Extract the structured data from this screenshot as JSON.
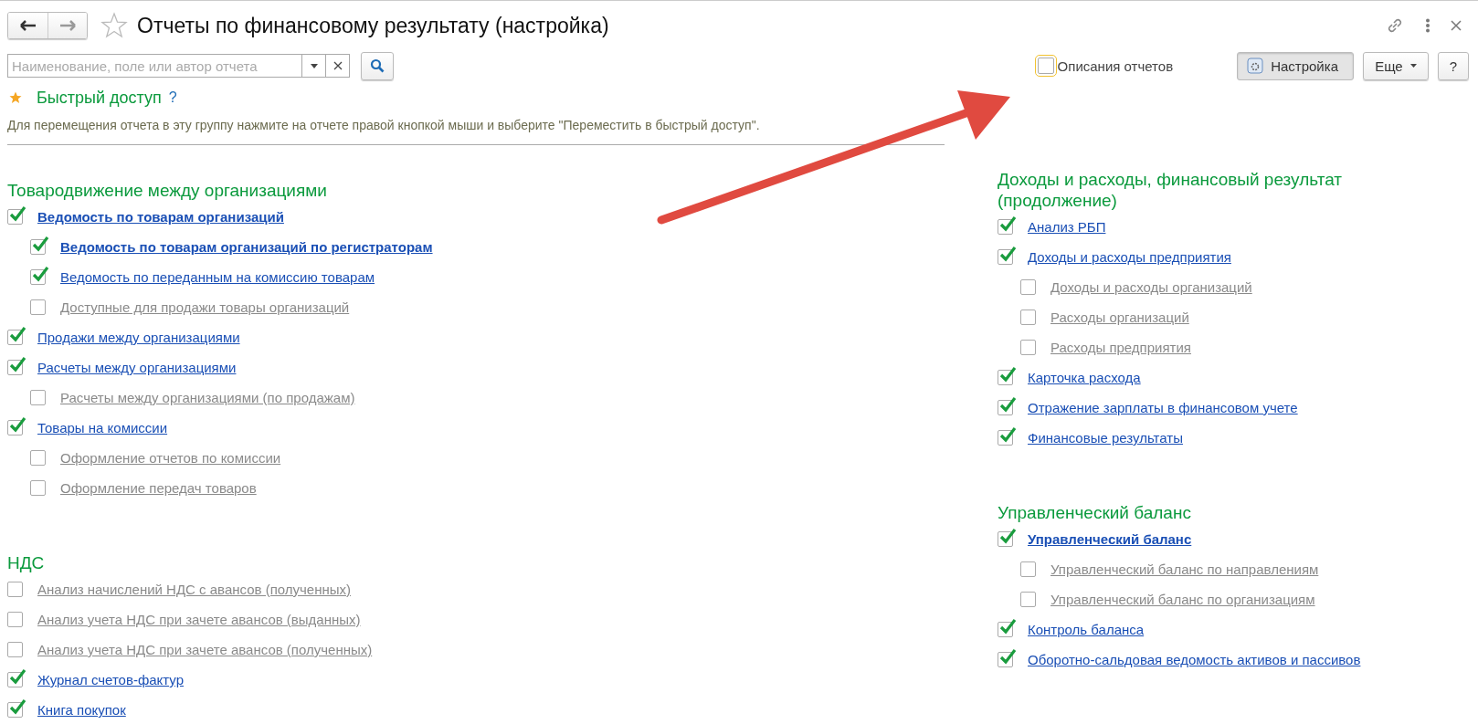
{
  "window": {
    "title": "Отчеты по финансовому результату (настройка)",
    "favorite": false
  },
  "search": {
    "placeholder": "Наименование, поле или автор отчета"
  },
  "descriptions_toggle": {
    "label": "Описания отчетов",
    "checked": false
  },
  "buttons": [
    {
      "kind": "settings",
      "label": "Настройка",
      "pressed": true
    },
    {
      "kind": "menu",
      "label": "Еще",
      "pressed": false
    },
    {
      "kind": "help",
      "label": "?",
      "pressed": false
    }
  ],
  "quick_access": {
    "title": "Быстрый доступ",
    "help": "?",
    "hint": "Для перемещения отчета в эту группу нажмите на отчете правой кнопкой мыши и выберите \"Переместить в быстрый доступ\"."
  },
  "columns": [
    {
      "groups": [
        {
          "title": "Товародвижение между организациями",
          "items": [
            {
              "label": "Ведомость по товарам организаций",
              "checked": true,
              "bold": true,
              "children": [
                {
                  "label": "Ведомость по товарам организаций по регистраторам",
                  "checked": true,
                  "bold": true
                },
                {
                  "label": "Ведомость по переданным на комиссию товарам",
                  "checked": true,
                  "bold": false
                },
                {
                  "label": "Доступные для продажи товары организаций",
                  "checked": false,
                  "bold": false
                }
              ]
            },
            {
              "label": "Продажи между организациями",
              "checked": true,
              "bold": false
            },
            {
              "label": "Расчеты между организациями",
              "checked": true,
              "bold": false,
              "children": [
                {
                  "label": "Расчеты между организациями (по продажам)",
                  "checked": false,
                  "bold": false
                }
              ]
            },
            {
              "label": "Товары на комиссии",
              "checked": true,
              "bold": false,
              "children": [
                {
                  "label": "Оформление отчетов по комиссии",
                  "checked": false,
                  "bold": false
                },
                {
                  "label": "Оформление передач товаров",
                  "checked": false,
                  "bold": false
                }
              ]
            }
          ]
        },
        {
          "title": "НДС",
          "items": [
            {
              "label": "Анализ начислений НДС с авансов (полученных)",
              "checked": false,
              "bold": false
            },
            {
              "label": "Анализ учета НДС при зачете авансов (выданных)",
              "checked": false,
              "bold": false
            },
            {
              "label": "Анализ учета НДС при зачете авансов (полученных)",
              "checked": false,
              "bold": false
            },
            {
              "label": "Журнал счетов-фактур",
              "checked": true,
              "bold": false
            },
            {
              "label": "Книга покупок",
              "checked": true,
              "bold": false
            }
          ]
        }
      ]
    },
    {
      "groups": [
        {
          "title": "Доходы и расходы, финансовый результат (продолжение)",
          "items": [
            {
              "label": "Анализ РБП",
              "checked": true,
              "bold": false
            },
            {
              "label": "Доходы и расходы предприятия",
              "checked": true,
              "bold": false,
              "children": [
                {
                  "label": "Доходы и расходы организаций",
                  "checked": false,
                  "bold": false
                },
                {
                  "label": "Расходы организаций",
                  "checked": false,
                  "bold": false
                },
                {
                  "label": "Расходы предприятия",
                  "checked": false,
                  "bold": false
                }
              ]
            },
            {
              "label": "Карточка расхода",
              "checked": true,
              "bold": false
            },
            {
              "label": "Отражение зарплаты в финансовом учете",
              "checked": true,
              "bold": false
            },
            {
              "label": "Финансовые результаты",
              "checked": true,
              "bold": false
            }
          ]
        },
        {
          "title": "Управленческий баланс",
          "items": [
            {
              "label": "Управленческий баланс",
              "checked": true,
              "bold": true,
              "children": [
                {
                  "label": "Управленческий баланс по направлениям",
                  "checked": false,
                  "bold": false
                },
                {
                  "label": "Управленческий баланс по организациям",
                  "checked": false,
                  "bold": false
                }
              ]
            },
            {
              "label": "Контроль баланса",
              "checked": true,
              "bold": false
            },
            {
              "label": "Оборотно-сальдовая ведомость активов и пассивов",
              "checked": true,
              "bold": false
            }
          ]
        }
      ]
    }
  ]
}
